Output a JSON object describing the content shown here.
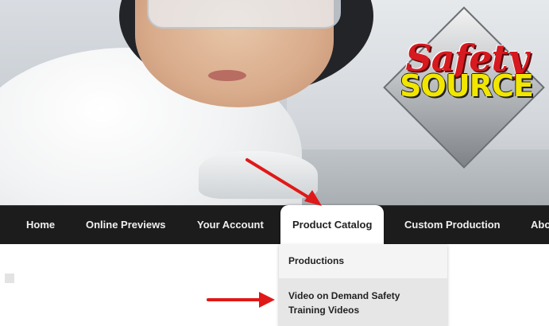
{
  "logo": {
    "top_word": "Safety",
    "bottom_word": "SOURCE"
  },
  "nav": {
    "items": [
      {
        "label": "Home"
      },
      {
        "label": "Online Previews"
      },
      {
        "label": "Your Account"
      },
      {
        "label": "Product Catalog"
      },
      {
        "label": "Custom Production"
      },
      {
        "label": "Abo"
      }
    ],
    "active_index": 3
  },
  "dropdown": {
    "items": [
      {
        "label": "Productions"
      },
      {
        "label": "Video on Demand Safety"
      },
      {
        "label": "Training Videos"
      }
    ]
  },
  "colors": {
    "nav_bg": "#1c1c1c",
    "arrow": "#e01818",
    "logo_red": "#d71920",
    "logo_yellow": "#f2e600"
  },
  "icons": {
    "annotation_arrow_1": "arrow-annotation-icon",
    "annotation_arrow_2": "arrow-annotation-icon"
  }
}
